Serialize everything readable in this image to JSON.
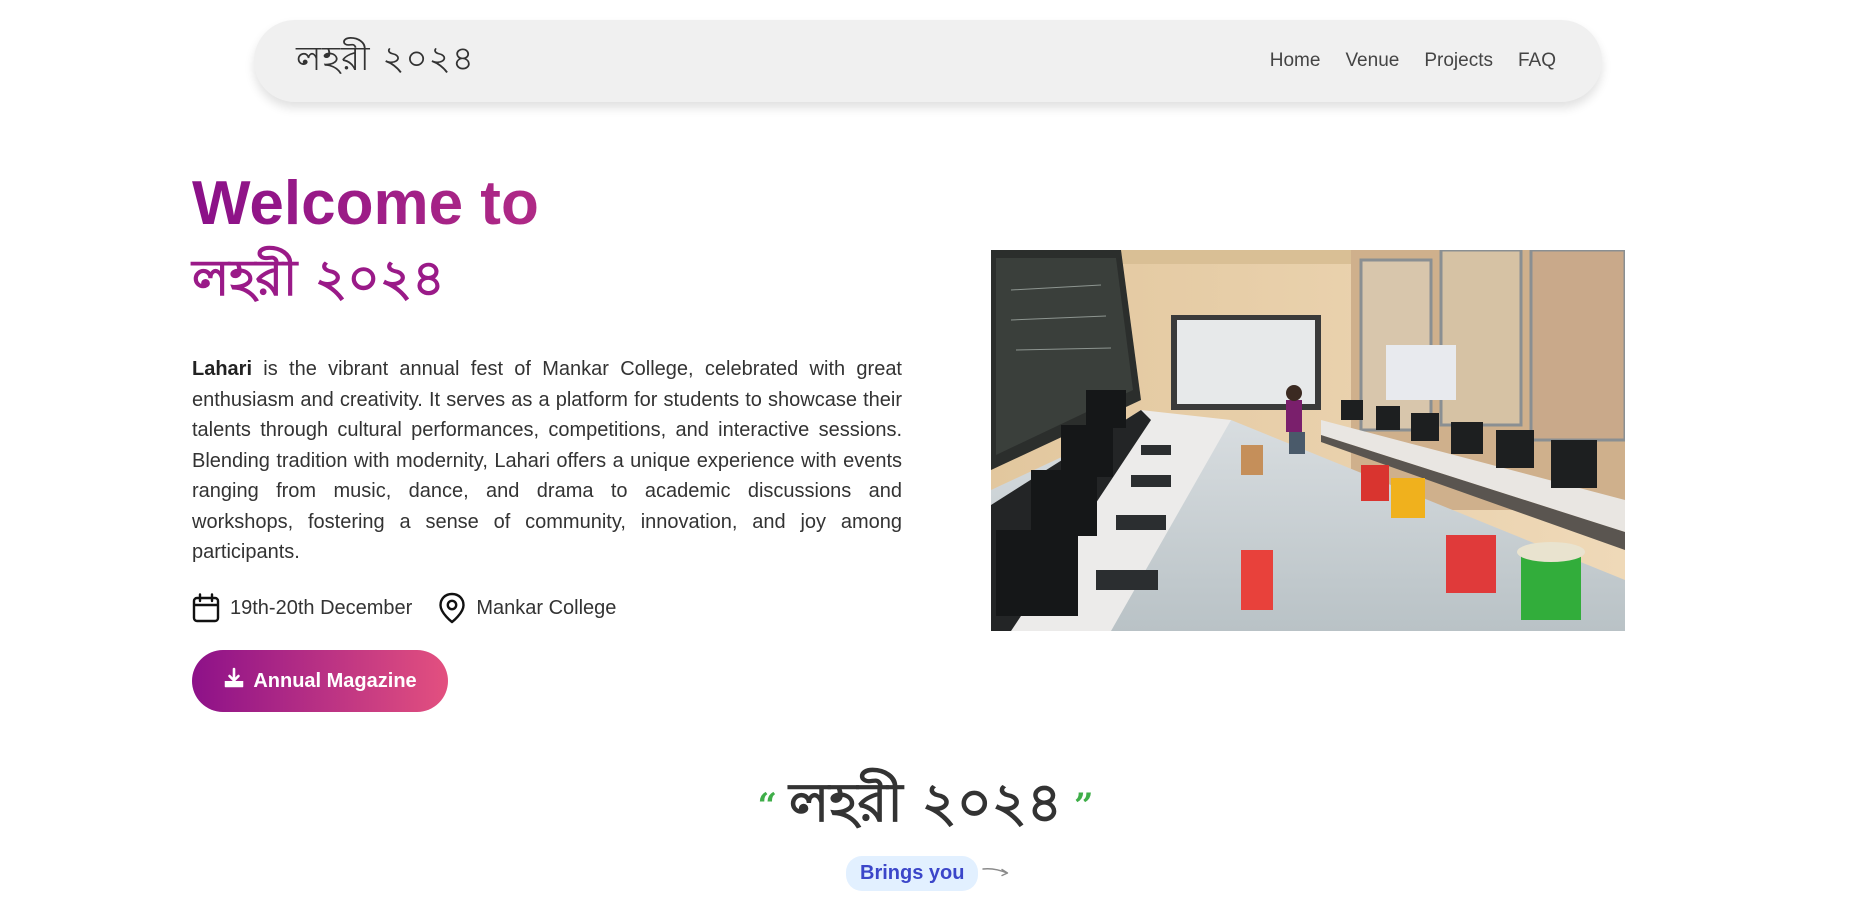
{
  "navbar": {
    "brand": "লহরী ২০২৪",
    "links": [
      "Home",
      "Venue",
      "Projects",
      "FAQ"
    ]
  },
  "hero": {
    "title": "Welcome to",
    "subtitle": "লহরী ২০২৪",
    "description_bold": "Lahari",
    "description": " is the vibrant annual fest of Mankar College, celebrated with great enthusiasm and creativity. It serves as a platform for students to showcase their talents through cultural performances, competitions, and interactive sessions. Blending tradition with modernity, Lahari offers a unique experience with events ranging from music, dance, and drama to academic discussions and workshops, fostering a sense of community, innovation, and joy among participants.",
    "date": "19th-20th December",
    "venue": "Mankar College",
    "button_label": "Annual Magazine"
  },
  "quote": {
    "open_mark": "“",
    "text": "লহরী ২০২৪",
    "close_mark": "”",
    "tagline": "Brings you"
  },
  "colors": {
    "title_gradient": [
      "#8a1088",
      "#b02a86"
    ],
    "button_gradient": [
      "#8d1189",
      "#e3507f"
    ],
    "quote_mark": "#3fae49",
    "tagline_text": "#3b46c9",
    "tagline_bg": "#e2f0ff"
  },
  "icons": {
    "date": "calendar-icon",
    "venue": "map-pin-icon",
    "button": "download-icon",
    "tagline": "arrow-right-icon"
  }
}
